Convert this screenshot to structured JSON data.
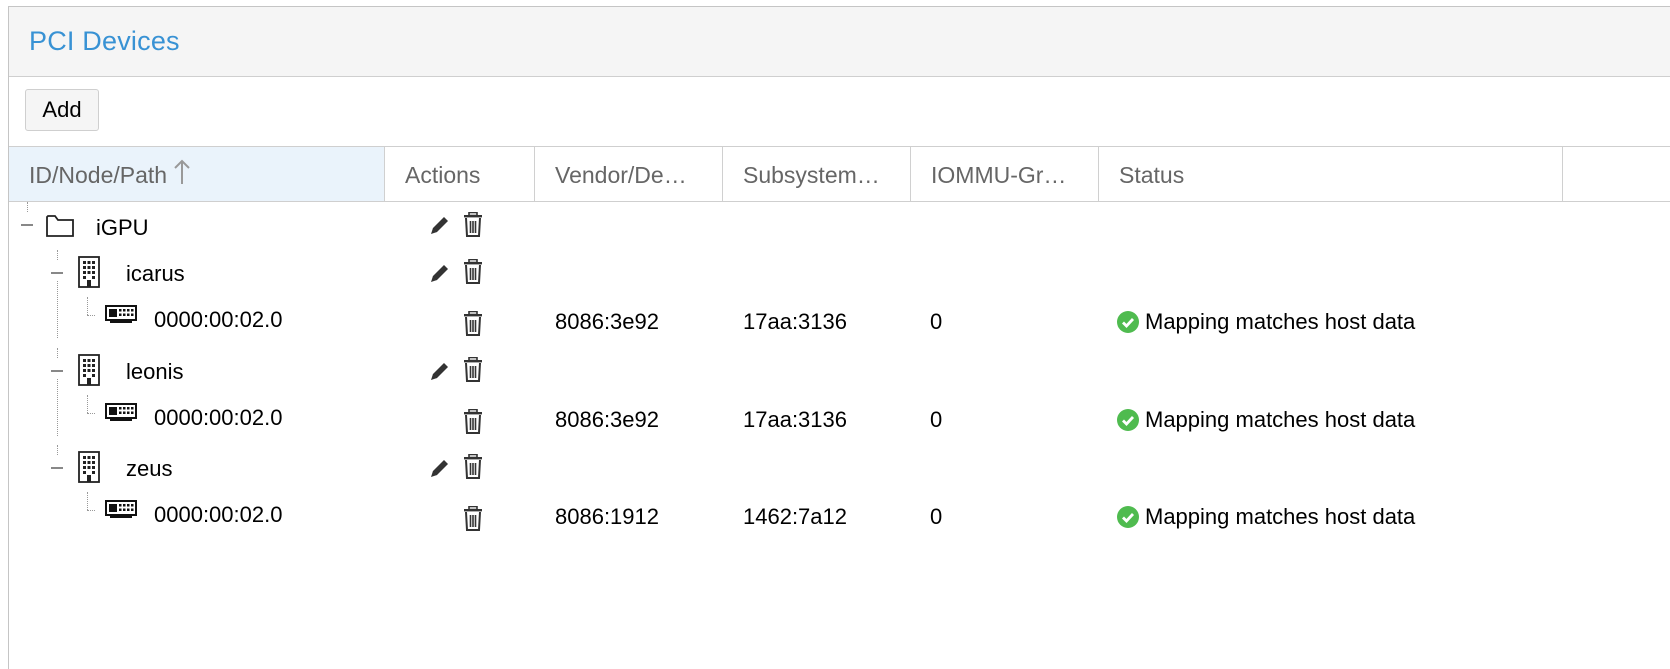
{
  "panel": {
    "title": "PCI Devices"
  },
  "toolbar": {
    "add_label": "Add"
  },
  "columns": {
    "id": "ID/Node/Path",
    "actions": "Actions",
    "vendor": "Vendor/De…",
    "subsystem": "Subsystem…",
    "iommu": "IOMMU-Gr…",
    "status": "Status"
  },
  "colors": {
    "accent": "#3892d4",
    "ok": "#4fbb4f",
    "sorted_header": "#eaf3fb"
  },
  "tree": {
    "root": {
      "label": "iGPU",
      "icon": "folder-icon"
    },
    "nodes": [
      {
        "label": "icarus",
        "icon": "building-icon",
        "path": {
          "label": "0000:00:02.0",
          "vendor": "8086:3e92",
          "subsystem": "17aa:3136",
          "iommu": "0",
          "status": "Mapping matches host data"
        }
      },
      {
        "label": "leonis",
        "icon": "building-icon",
        "path": {
          "label": "0000:00:02.0",
          "vendor": "8086:3e92",
          "subsystem": "17aa:3136",
          "iommu": "0",
          "status": "Mapping matches host data"
        }
      },
      {
        "label": "zeus",
        "icon": "building-icon",
        "path": {
          "label": "0000:00:02.0",
          "vendor": "8086:1912",
          "subsystem": "1462:7a12",
          "iommu": "0",
          "status": "Mapping matches host data"
        }
      }
    ]
  }
}
